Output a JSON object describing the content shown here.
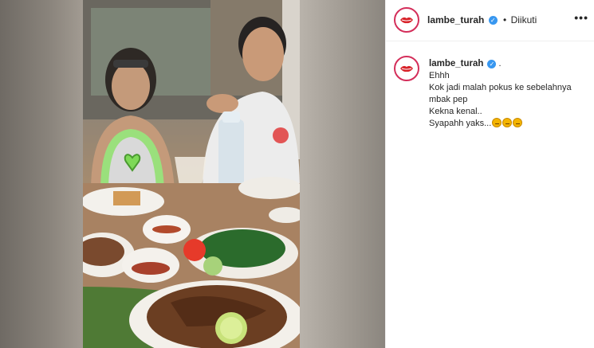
{
  "post": {
    "username": "lambe_turah",
    "verified_icon": "verified-badge-icon",
    "follow_separator": "•",
    "follow_state": "Diikuti",
    "more_label": "•••"
  },
  "caption": {
    "username": "lambe_turah",
    "after_name": ".",
    "lines": [
      "Ehhh",
      "Kok jadi malah pokus ke sebelahnya",
      "mbak pep",
      "Kekna kenal..",
      "Syapahh yaks..."
    ],
    "trailing_emojis": [
      "thinking-face-emoji",
      "thinking-face-emoji",
      "thinking-face-emoji"
    ]
  },
  "colors": {
    "verified": "#3897f0",
    "avatar_ring": "#d42e5a",
    "heart_sticker": "#7ed957"
  }
}
